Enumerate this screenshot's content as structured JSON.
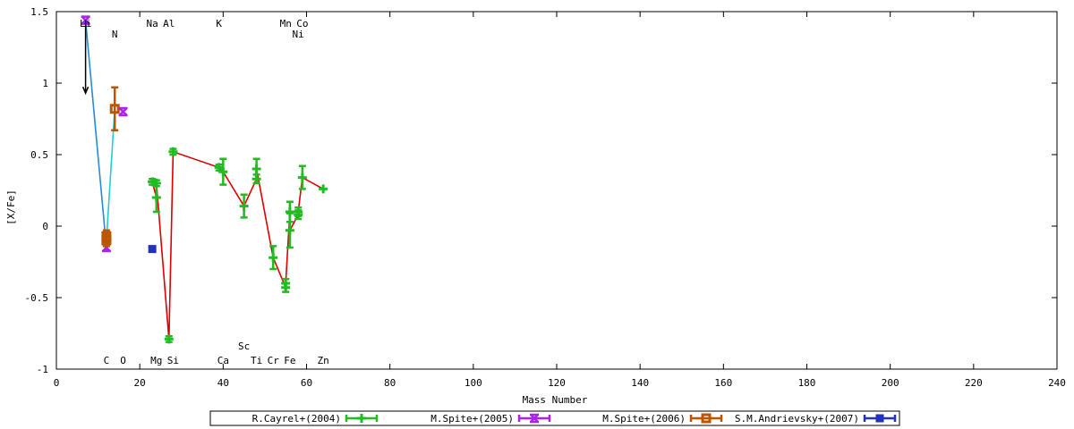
{
  "chart_data": {
    "type": "scatter",
    "xlabel": "Mass Number",
    "ylabel": "[X/Fe]",
    "xlim": [
      0,
      240
    ],
    "ylim": [
      -1,
      1.5
    ],
    "xticks": [
      0,
      20,
      40,
      60,
      80,
      100,
      120,
      140,
      160,
      180,
      200,
      220,
      240
    ],
    "yticks": [
      -1,
      -0.5,
      0,
      0.5,
      1,
      1.5
    ],
    "ytick_labels": [
      "-1",
      "-0.5",
      "0",
      "0.5",
      "1",
      "1.5"
    ],
    "grid": false,
    "legend_position": "bottom",
    "element_labels_top": [
      {
        "label": "Li",
        "x": 7,
        "row": 1
      },
      {
        "label": "N",
        "x": 14,
        "row": 2
      },
      {
        "label": "Na",
        "x": 23,
        "row": 1
      },
      {
        "label": "Al",
        "x": 27,
        "row": 1
      },
      {
        "label": "K",
        "x": 39,
        "row": 1
      },
      {
        "label": "Mn",
        "x": 55,
        "row": 1
      },
      {
        "label": "Co",
        "x": 59,
        "row": 1
      },
      {
        "label": "Ni",
        "x": 58,
        "row": 2
      }
    ],
    "element_labels_bottom": [
      {
        "label": "C",
        "x": 12,
        "row": 2
      },
      {
        "label": "O",
        "x": 16,
        "row": 2
      },
      {
        "label": "Mg",
        "x": 24,
        "row": 2
      },
      {
        "label": "Si",
        "x": 28,
        "row": 2
      },
      {
        "label": "Sc",
        "x": 45,
        "row": 1
      },
      {
        "label": "Ca",
        "x": 40,
        "row": 2
      },
      {
        "label": "Ti",
        "x": 48,
        "row": 2
      },
      {
        "label": "Cr",
        "x": 52,
        "row": 2
      },
      {
        "label": "Fe",
        "x": 56,
        "row": 2
      },
      {
        "label": "Zn",
        "x": 64,
        "row": 2
      }
    ],
    "series": [
      {
        "name": "R.Cayrel+(2004)",
        "color": "#22bb22",
        "line_color": "#dd0000",
        "marker": "plus",
        "points": [
          {
            "x": 23,
            "y": 0.31,
            "err": 0.02
          },
          {
            "x": 24,
            "y": 0.2,
            "err": 0.1
          },
          {
            "x": 24,
            "y": 0.3,
            "err": 0.02
          },
          {
            "x": 27,
            "y": -0.79,
            "err": 0.02
          },
          {
            "x": 28,
            "y": 0.52,
            "err": 0.02
          },
          {
            "x": 39,
            "y": 0.41,
            "err": 0.02
          },
          {
            "x": 40,
            "y": 0.38,
            "err": 0.09
          },
          {
            "x": 45,
            "y": 0.14,
            "err": 0.08
          },
          {
            "x": 48,
            "y": 0.33,
            "err": 0.03
          },
          {
            "x": 48,
            "y": 0.4,
            "err": 0.07
          },
          {
            "x": 52,
            "y": -0.22,
            "err": 0.08
          },
          {
            "x": 55,
            "y": -0.43,
            "err": 0.03
          },
          {
            "x": 55,
            "y": -0.4,
            "err": 0.03
          },
          {
            "x": 56,
            "y": 0.1,
            "err": 0.07
          },
          {
            "x": 56,
            "y": -0.03,
            "err": 0.12
          },
          {
            "x": 58,
            "y": 0.08,
            "err": 0.03
          },
          {
            "x": 58,
            "y": 0.1,
            "err": 0.03
          },
          {
            "x": 59,
            "y": 0.34,
            "err": 0.08
          },
          {
            "x": 64,
            "y": 0.26,
            "err": 0.01
          }
        ]
      },
      {
        "name": "M.Spite+(2005)",
        "color": "#aa22ee",
        "line_color": "#2a8ad6",
        "marker": "x-box",
        "points": [
          {
            "x": 7,
            "y": 1.44,
            "err": 0.01
          },
          {
            "x": 12,
            "y": -0.15,
            "err": 0.02
          }
        ]
      },
      {
        "name": "M.Spite+(2006)",
        "color": "#bb5500",
        "line_color": "#22cccc",
        "marker": "square",
        "points": [
          {
            "x": 12,
            "y": -0.07,
            "err": 0.04
          },
          {
            "x": 12,
            "y": -0.1,
            "err": 0.04
          },
          {
            "x": 14,
            "y": 0.82,
            "err": 0.15
          }
        ]
      },
      {
        "name": "S.M.Andrievsky+(2007)",
        "color": "#2233bb",
        "marker": "filled-square",
        "points": [
          {
            "x": 23,
            "y": -0.16,
            "err": 0
          }
        ]
      }
    ],
    "extra_markers": [
      {
        "x": 16,
        "y": 0.8,
        "color": "#aa22ee",
        "marker": "x-box"
      }
    ],
    "arrows": [
      {
        "x": 7,
        "y_from": 1.44,
        "y_to": 0.93,
        "color": "#000000"
      }
    ]
  }
}
